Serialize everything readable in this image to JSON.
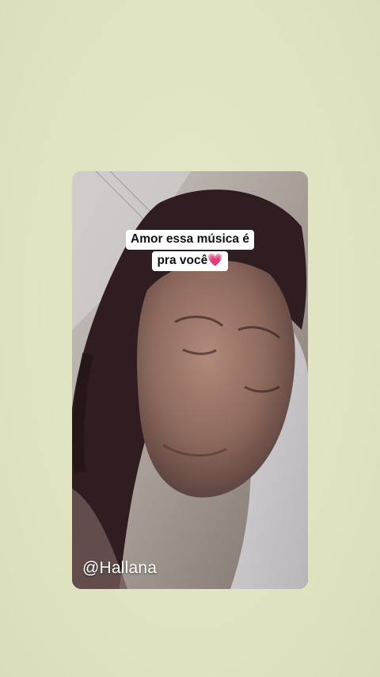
{
  "story": {
    "caption_line1": "Amor essa música é",
    "caption_line2": "pra você",
    "caption_emoji": "💗",
    "handle": "@Hallana"
  },
  "colors": {
    "background": "#e2e6c4",
    "caption_bg": "#ffffff",
    "heart": "#e8336c"
  }
}
